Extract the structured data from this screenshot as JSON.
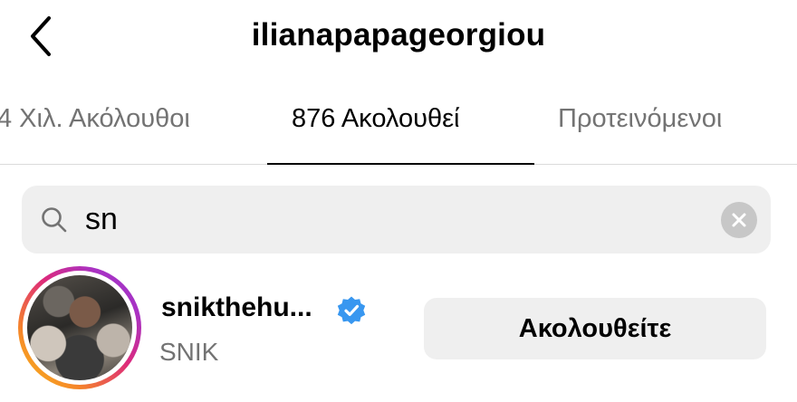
{
  "header": {
    "title": "ilianapapageorgiou",
    "back_icon": "chevron-left-icon"
  },
  "tabs": [
    {
      "label": "4 Χιλ. Ακόλουθοι",
      "active": false
    },
    {
      "label": "876 Ακολουθεί",
      "active": true
    },
    {
      "label": "Προτεινόμενοι",
      "active": false
    }
  ],
  "search": {
    "value": "sn",
    "icon": "search-icon",
    "clear_icon": "clear-icon"
  },
  "results": [
    {
      "username": "snikthehu...",
      "full_name": "SNIK",
      "verified": true,
      "button_label": "Ακολουθείτε",
      "has_story_ring": true
    }
  ],
  "colors": {
    "secondary_text": "#737373",
    "verified_badge": "#3897f0",
    "search_bg": "#efefef",
    "button_bg": "#efefef",
    "clear_button": "#c7c7c7"
  }
}
